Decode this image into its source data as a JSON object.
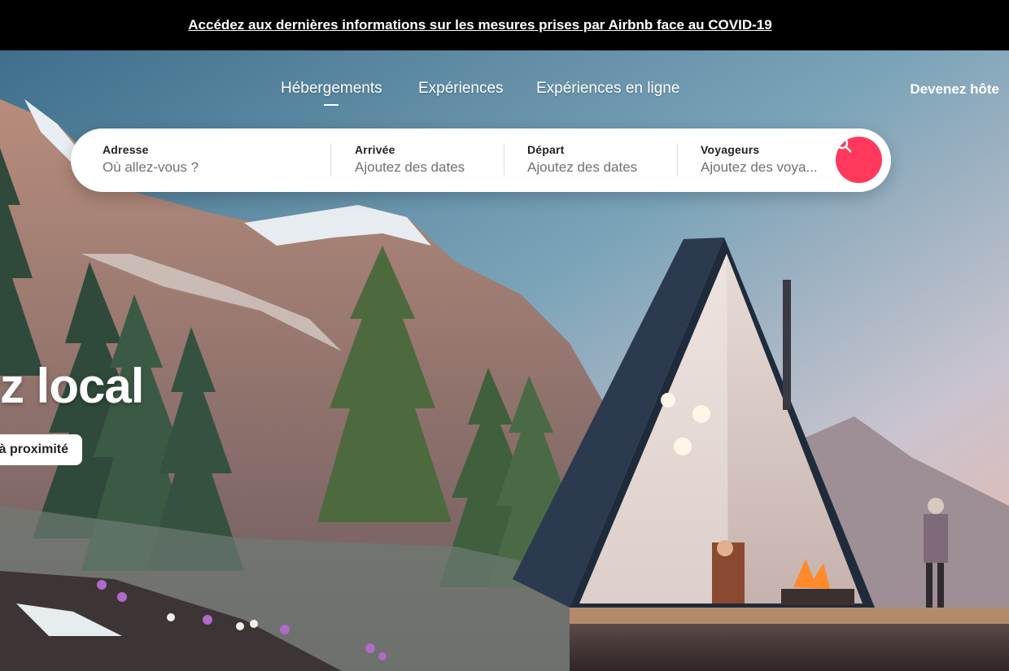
{
  "banner": {
    "text": "Accédez aux dernières informations sur les mesures prises par Airbnb face au COVID-19"
  },
  "nav": {
    "tabs": [
      {
        "label": "Hébergements"
      },
      {
        "label": "Expériences"
      },
      {
        "label": "Expériences en ligne"
      }
    ],
    "host_label": "Devenez hôte"
  },
  "search": {
    "fields": [
      {
        "label": "Adresse",
        "placeholder": "Où allez-vous ?"
      },
      {
        "label": "Arrivée",
        "placeholder": "Ajoutez des dates"
      },
      {
        "label": "Départ",
        "placeholder": "Ajoutez des dates"
      },
      {
        "label": "Voyageurs",
        "placeholder": "Ajoutez des voya..."
      }
    ],
    "button_icon": "search-icon"
  },
  "hero": {
    "headline": "z local",
    "cta_label": "à proximité"
  },
  "colors": {
    "accent": "#ff385c",
    "banner_bg": "#000000"
  }
}
